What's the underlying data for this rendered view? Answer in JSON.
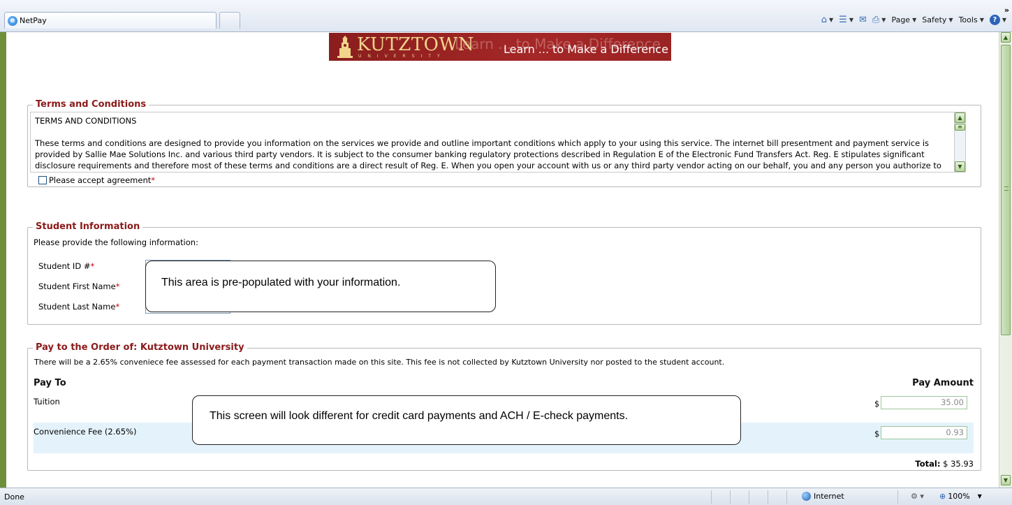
{
  "browser": {
    "tab_title": "NetPay",
    "tab_icon": "e",
    "toolbar": {
      "page_label": "Page",
      "safety_label": "Safety",
      "tools_label": "Tools",
      "help_glyph": "?",
      "overflow_glyph": "»"
    }
  },
  "banner": {
    "logo_text": "KUTZTOWN",
    "logo_subtext": "UNIVERSITY",
    "ghost_text": "Learn ... to Make a Difference",
    "tagline": "Learn ... to Make a Difference"
  },
  "terms": {
    "legend": "Terms and Conditions",
    "heading": "TERMS AND CONDITIONS",
    "body": "These terms and conditions are designed to provide you information on the services we provide and outline important conditions which apply to your using this service.  The internet bill presentment and payment service is provided by Sallie Mae Solutions Inc. and various third party vendors.  It is subject to the consumer banking regulatory protections described in Regulation E of the Electronic Fund Transfers Act.  Reg. E stipulates significant disclosure requirements and therefore most of these terms and conditions are a direct result of Reg. E.  When you open your account with us or any third party vendor acting on our behalf, you and any person you authorize to",
    "accept_label": "Please accept agreement",
    "required_mark": "*"
  },
  "student": {
    "legend": "Student Information",
    "intro": "Please provide the following information:",
    "fields": [
      {
        "label": "Student ID #",
        "value": ""
      },
      {
        "label": "Student First Name",
        "value": ""
      },
      {
        "label": "Student Last Name",
        "value": ""
      }
    ],
    "required_mark": "*",
    "callout": "This area is pre-populated with your information."
  },
  "payment": {
    "legend": "Pay to the Order of: Kutztown University",
    "notice": "There will be a 2.65% conveniece fee assessed for each payment transaction made on this site. This fee is not collected by Kutztown University nor posted to the student account.",
    "col_pay_to": "Pay To",
    "col_amount": "Pay Amount",
    "rows": [
      {
        "label": "Tuition",
        "currency": "$",
        "amount": "35.00"
      },
      {
        "label": "Convenience Fee (2.65%)",
        "currency": "$",
        "amount": "0.93"
      }
    ],
    "total_label": "Total:",
    "total_value": "$  35.93",
    "callout": "This screen will look different for credit card payments and ACH / E-check payments."
  },
  "statusbar": {
    "status": "Done",
    "zone": "Internet",
    "zoom": "100%"
  },
  "colors": {
    "legend": "#8b1a1a",
    "banner": "#a52727",
    "required": "#cc0000",
    "fee_row_bg": "#e4f3fb"
  }
}
